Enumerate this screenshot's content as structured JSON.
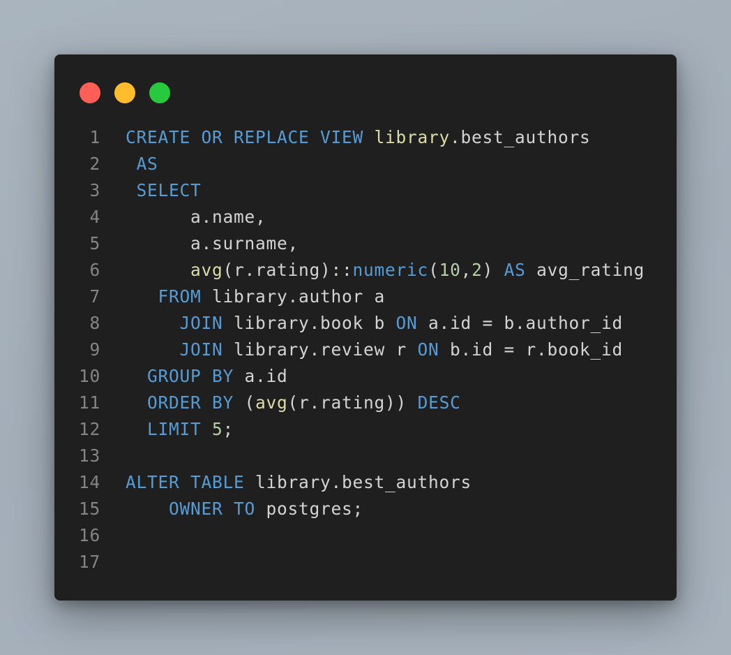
{
  "window": {
    "controls": [
      {
        "name": "close",
        "color": "#ff5f56"
      },
      {
        "name": "minimize",
        "color": "#ffbd2e"
      },
      {
        "name": "maximize",
        "color": "#27c93f"
      }
    ]
  },
  "editor": {
    "lines": [
      {
        "number": "1",
        "tokens": [
          {
            "text": "CREATE OR REPLACE VIEW ",
            "type": "keyword"
          },
          {
            "text": "library",
            "type": "func"
          },
          {
            "text": ".best_authors",
            "type": "ident"
          }
        ]
      },
      {
        "number": "2",
        "tokens": [
          {
            "text": " AS",
            "type": "keyword"
          }
        ]
      },
      {
        "number": "3",
        "tokens": [
          {
            "text": " SELECT",
            "type": "keyword"
          }
        ]
      },
      {
        "number": "4",
        "tokens": [
          {
            "text": "      a.name,",
            "type": "ident"
          }
        ]
      },
      {
        "number": "5",
        "tokens": [
          {
            "text": "      a.surname,",
            "type": "ident"
          }
        ]
      },
      {
        "number": "6",
        "tokens": [
          {
            "text": "      ",
            "type": "plain"
          },
          {
            "text": "avg",
            "type": "func"
          },
          {
            "text": "(r.rating)::",
            "type": "ident"
          },
          {
            "text": "numeric",
            "type": "keyword"
          },
          {
            "text": "(",
            "type": "ident"
          },
          {
            "text": "10",
            "type": "number"
          },
          {
            "text": ",",
            "type": "ident"
          },
          {
            "text": "2",
            "type": "number"
          },
          {
            "text": ") ",
            "type": "ident"
          },
          {
            "text": "AS",
            "type": "keyword"
          },
          {
            "text": " avg_rating",
            "type": "ident"
          }
        ]
      },
      {
        "number": "7",
        "tokens": [
          {
            "text": "   FROM",
            "type": "keyword"
          },
          {
            "text": " library.author a",
            "type": "ident"
          }
        ]
      },
      {
        "number": "8",
        "tokens": [
          {
            "text": "     JOIN",
            "type": "keyword"
          },
          {
            "text": " library.book b ",
            "type": "ident"
          },
          {
            "text": "ON",
            "type": "keyword"
          },
          {
            "text": " a.id = b.author_id",
            "type": "ident"
          }
        ]
      },
      {
        "number": "9",
        "tokens": [
          {
            "text": "     JOIN",
            "type": "keyword"
          },
          {
            "text": " library.review r ",
            "type": "ident"
          },
          {
            "text": "ON",
            "type": "keyword"
          },
          {
            "text": " b.id = r.book_id",
            "type": "ident"
          }
        ]
      },
      {
        "number": "10",
        "tokens": [
          {
            "text": "  GROUP BY",
            "type": "keyword"
          },
          {
            "text": " a.id",
            "type": "ident"
          }
        ]
      },
      {
        "number": "11",
        "tokens": [
          {
            "text": "  ORDER BY",
            "type": "keyword"
          },
          {
            "text": " (",
            "type": "ident"
          },
          {
            "text": "avg",
            "type": "func"
          },
          {
            "text": "(r.rating)) ",
            "type": "ident"
          },
          {
            "text": "DESC",
            "type": "keyword"
          }
        ]
      },
      {
        "number": "12",
        "tokens": [
          {
            "text": "  LIMIT",
            "type": "keyword"
          },
          {
            "text": " ",
            "type": "plain"
          },
          {
            "text": "5",
            "type": "number"
          },
          {
            "text": ";",
            "type": "ident"
          }
        ]
      },
      {
        "number": "13",
        "tokens": []
      },
      {
        "number": "14",
        "tokens": [
          {
            "text": "ALTER TABLE",
            "type": "keyword"
          },
          {
            "text": " library.best_authors",
            "type": "ident"
          }
        ]
      },
      {
        "number": "15",
        "tokens": [
          {
            "text": "    OWNER TO",
            "type": "keyword"
          },
          {
            "text": " postgres;",
            "type": "ident"
          }
        ]
      },
      {
        "number": "16",
        "tokens": []
      },
      {
        "number": "17",
        "tokens": []
      }
    ]
  }
}
